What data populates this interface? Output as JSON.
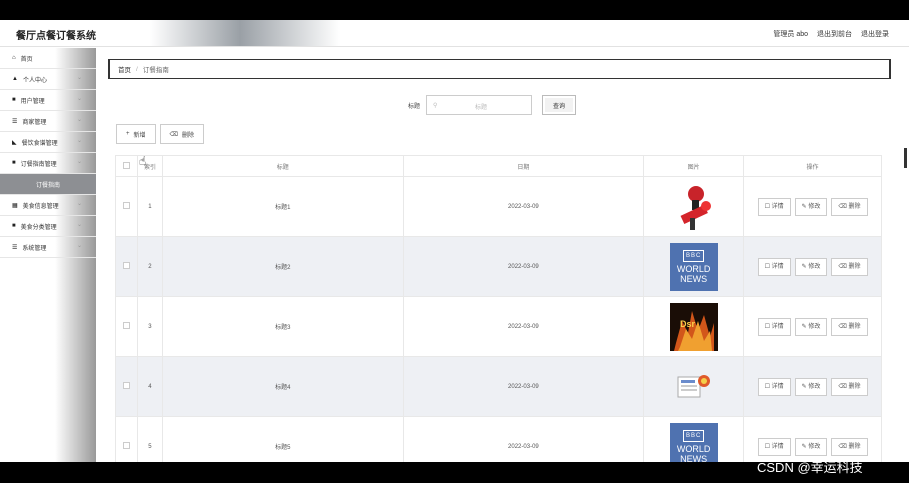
{
  "header": {
    "app_title": "餐厅点餐订餐系统",
    "user_label": "管理员 abo",
    "back_link": "退出到前台",
    "logout_link": "退出登录"
  },
  "sidebar": {
    "items": [
      {
        "icon": "home-icon",
        "glyph": "⌂",
        "label": "首页"
      },
      {
        "icon": "person-icon",
        "glyph": "▲",
        "label": "个人中心"
      },
      {
        "icon": "grid-icon",
        "glyph": "■",
        "label": "用户管理"
      },
      {
        "icon": "list-icon",
        "glyph": "☰",
        "label": "商家管理"
      },
      {
        "icon": "bowl-icon",
        "glyph": "◣",
        "label": "餐饮食谱管理"
      },
      {
        "icon": "grid-icon",
        "glyph": "■",
        "label": "订餐指南管理"
      },
      {
        "icon": "",
        "glyph": "",
        "label": "订餐指南"
      },
      {
        "icon": "grid-icon",
        "glyph": "▦",
        "label": "美食信息管理"
      },
      {
        "icon": "grid-icon",
        "glyph": "■",
        "label": "美食分类管理"
      },
      {
        "icon": "list-icon",
        "glyph": "☰",
        "label": "系统管理"
      }
    ]
  },
  "breadcrumb": {
    "home": "首页",
    "separator": "/",
    "current": "订餐指南"
  },
  "search": {
    "label": "标题",
    "placeholder": "标题",
    "button": "查询"
  },
  "toolbar": {
    "add": "新增",
    "delete": "删除"
  },
  "table": {
    "headers": [
      "索引",
      "标题",
      "日期",
      "图片",
      "操作"
    ],
    "rows": [
      {
        "index": "1",
        "title": "标题1",
        "date": "2022-03-09",
        "image": "microphone"
      },
      {
        "index": "2",
        "title": "标题2",
        "date": "2022-03-09",
        "image": "bbc"
      },
      {
        "index": "3",
        "title": "标题3",
        "date": "2022-03-09",
        "image": "fire"
      },
      {
        "index": "4",
        "title": "标题4",
        "date": "2022-03-09",
        "image": "newspaper"
      },
      {
        "index": "5",
        "title": "标题5",
        "date": "2022-03-09",
        "image": "bbc"
      }
    ],
    "ops": {
      "detail": "详情",
      "edit": "修改",
      "delete": "删除"
    }
  },
  "bbc_image": {
    "logo": "BBC",
    "line1": "WORLD",
    "line2": "NEWS"
  },
  "watermark": "CSDN @幸运科技"
}
